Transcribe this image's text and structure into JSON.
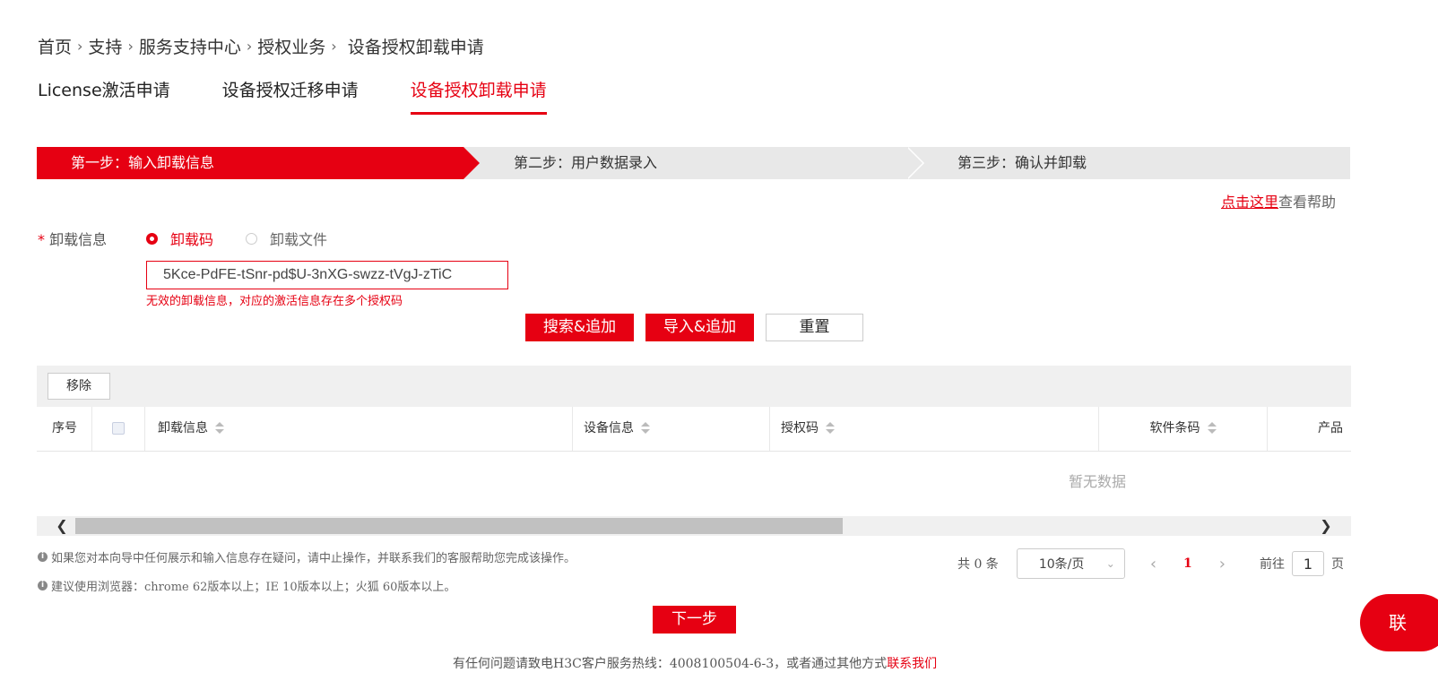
{
  "breadcrumb": {
    "items": [
      "首页",
      "支持",
      "服务支持中心",
      "授权业务"
    ],
    "separator": "›",
    "current": "设备授权卸载申请"
  },
  "tabs": [
    {
      "label": "License激活申请"
    },
    {
      "label": "设备授权迁移申请"
    },
    {
      "label": "设备授权卸载申请",
      "active": true
    }
  ],
  "steps": [
    {
      "label": "第一步：输入卸载信息",
      "active": true
    },
    {
      "label": "第二步：用户数据录入"
    },
    {
      "label": "第三步：确认并卸载"
    }
  ],
  "help": {
    "link_text": "点击这里",
    "suffix": "查看帮助"
  },
  "form": {
    "required_mark": "*",
    "label": "卸载信息",
    "radio_options": [
      {
        "label": "卸载码",
        "checked": true
      },
      {
        "label": "卸载文件",
        "checked": false
      }
    ],
    "input_value": "5Kce-PdFE-tSnr-pd$U-3nXG-swzz-tVgJ-zTiC",
    "error": "无效的卸载信息，对应的激活信息存在多个授权码",
    "buttons": {
      "search_add": "搜索&追加",
      "import_add": "导入&追加",
      "reset": "重置"
    }
  },
  "table": {
    "remove_label": "移除",
    "columns": [
      "序号",
      "",
      "卸载信息",
      "设备信息",
      "授权码",
      "软件条码",
      "产品"
    ],
    "empty_text": "暂无数据"
  },
  "notes": [
    "如果您对本向导中任何展示和输入信息存在疑问，请中止操作，并联系我们的客服帮助您完成该操作。",
    "建议使用浏览器：chrome 62版本以上；IE 10版本以上；火狐 60版本以上。"
  ],
  "pagination": {
    "total": "共 0 条",
    "page_size": "10条/页",
    "prev": "‹",
    "current_page": "1",
    "next": "›",
    "goto_prefix": "前往",
    "goto_value": "1",
    "goto_suffix": "页"
  },
  "next_button": "下一步",
  "footer": {
    "text": "有任何问题请致电H3C客户服务热线：4008100504-6-3，或者通过其他方式",
    "link": "联系我们"
  },
  "contact_float": "联",
  "colors": {
    "accent": "#e60012",
    "step_bg": "#e8e8e8"
  }
}
